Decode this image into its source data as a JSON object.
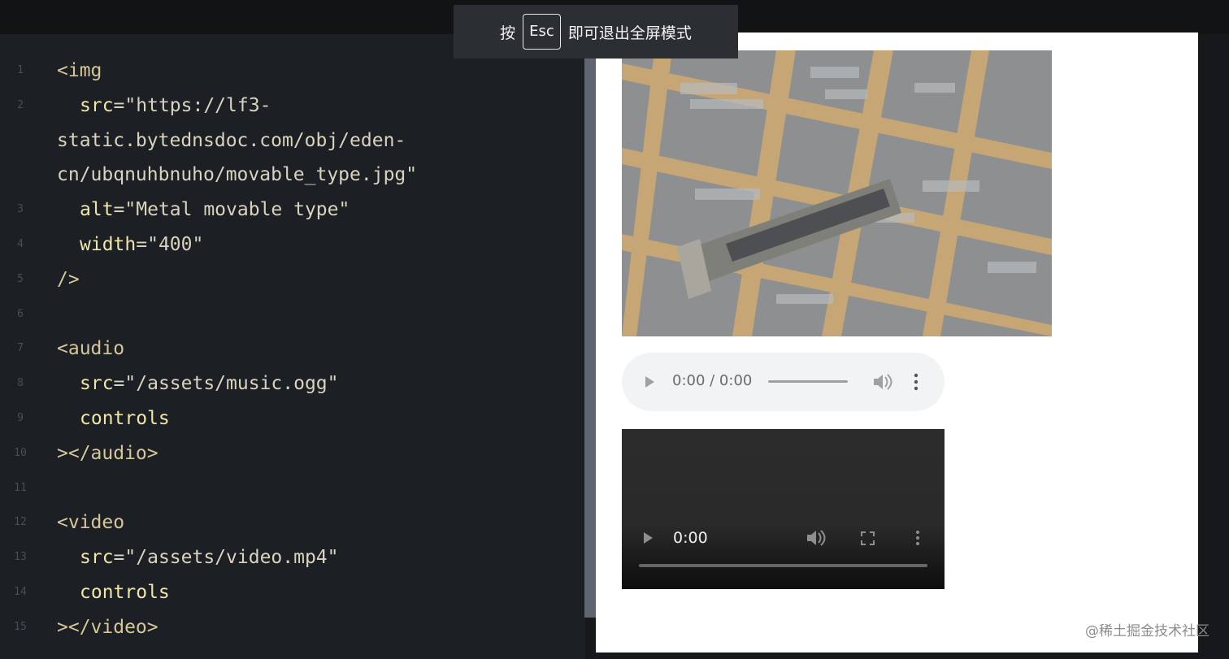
{
  "toast": {
    "before": "按",
    "key": "Esc",
    "after": "即可退出全屏模式"
  },
  "editor": {
    "lines": [
      {
        "n": "1",
        "tag": "<img"
      },
      {
        "n": "2",
        "attr": "src",
        "val": "\"https://lf3-"
      },
      {
        "n": "",
        "cont": "static.bytednsdoc.com/obj/eden-"
      },
      {
        "n": "",
        "cont": "cn/ubqnuhbnuho/movable_type.jpg\""
      },
      {
        "n": "3",
        "attr": "alt",
        "val": "\"Metal movable type\""
      },
      {
        "n": "4",
        "attr": "width",
        "val": "\"400\""
      },
      {
        "n": "5",
        "tag": "/>"
      },
      {
        "n": "6"
      },
      {
        "n": "7",
        "tag": "<audio"
      },
      {
        "n": "8",
        "attr": "src",
        "val": "\"/assets/music.ogg\""
      },
      {
        "n": "9",
        "attr_only": "controls"
      },
      {
        "n": "10",
        "tag": "></audio>"
      },
      {
        "n": "11"
      },
      {
        "n": "12",
        "tag": "<video"
      },
      {
        "n": "13",
        "attr": "src",
        "val": "\"/assets/video.mp4\""
      },
      {
        "n": "14",
        "attr_only": "controls"
      },
      {
        "n": "15",
        "tag": "></video>"
      }
    ]
  },
  "preview": {
    "audio": {
      "time": "0:00 / 0:00"
    },
    "video": {
      "time": "0:00"
    },
    "watermark": "@稀土掘金技术社区"
  },
  "colors": {
    "editor_bg": "#1c1f23",
    "preview_bg": "#ffffff",
    "toast_bg": "#2b2e33"
  },
  "icons": [
    "play-icon",
    "volume-icon",
    "more-options-icon",
    "fullscreen-icon"
  ]
}
